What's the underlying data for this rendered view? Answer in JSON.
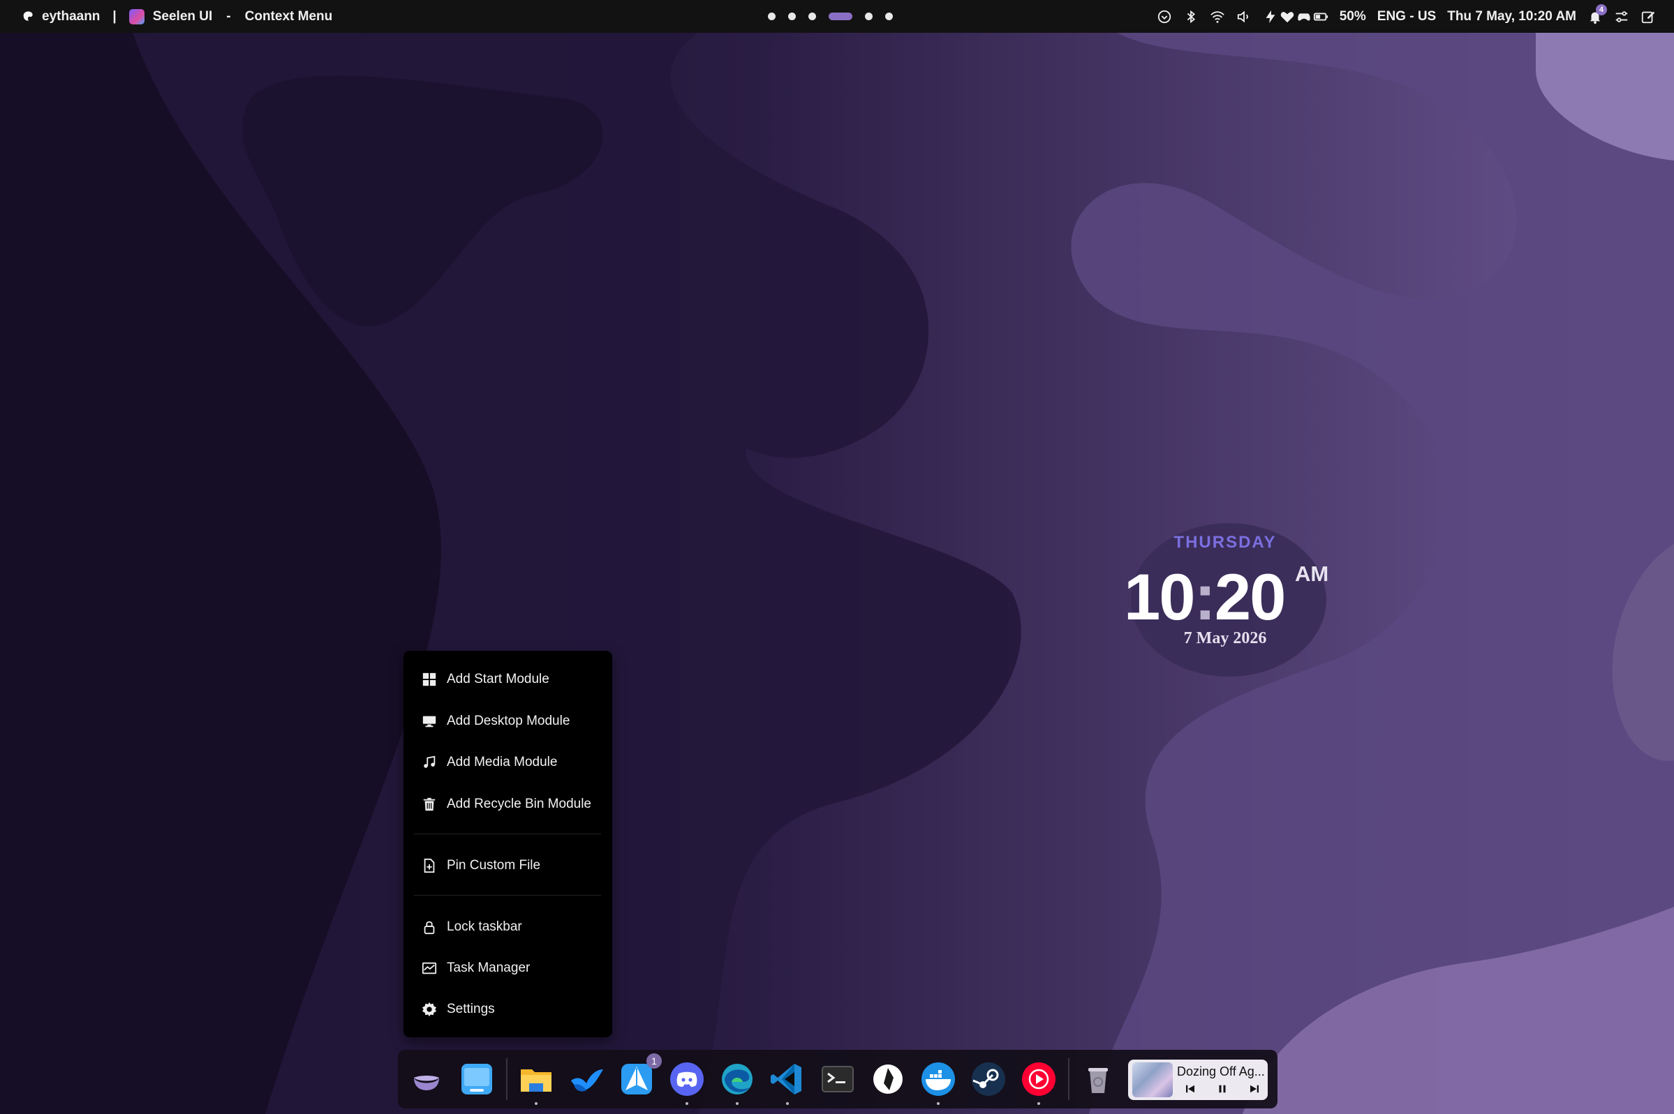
{
  "topbar": {
    "user": "eythaann",
    "separator": "|",
    "app_name": "Seelen UI",
    "dash": "-",
    "window_title": "Context Menu",
    "battery": "50%",
    "language": "ENG - US",
    "datetime": "Thu 7 May, 10:20 AM",
    "notification_count": "4",
    "workspaces": 6,
    "active_workspace": 4
  },
  "clock_widget": {
    "day": "THURSDAY",
    "hours": "10",
    "colon": ":",
    "minutes": "20",
    "ampm": "AM",
    "date": "7 May 2026"
  },
  "context_menu": {
    "items": [
      {
        "label": "Add Start Module",
        "icon": "windows-icon"
      },
      {
        "label": "Add Desktop Module",
        "icon": "monitor-icon"
      },
      {
        "label": "Add Media Module",
        "icon": "music-note-icon"
      },
      {
        "label": "Add Recycle Bin Module",
        "icon": "trash-icon"
      },
      {
        "label": "Pin Custom File",
        "icon": "file-plus-icon"
      },
      {
        "label": "Lock taskbar",
        "icon": "lock-icon"
      },
      {
        "label": "Task Manager",
        "icon": "task-manager-icon"
      },
      {
        "label": "Settings",
        "icon": "gear-icon"
      }
    ]
  },
  "dock": {
    "apps": [
      {
        "name": "seelen-start",
        "icon": "seelen-logo-icon"
      },
      {
        "name": "desktop",
        "icon": "desktop-icon"
      },
      {
        "name": "file-explorer",
        "icon": "folder-icon"
      },
      {
        "name": "bluesky",
        "icon": "bluesky-icon"
      },
      {
        "name": "spark-mail",
        "icon": "paper-plane-icon",
        "badge": "1"
      },
      {
        "name": "discord",
        "icon": "discord-icon"
      },
      {
        "name": "edge",
        "icon": "edge-icon"
      },
      {
        "name": "vscode",
        "icon": "vscode-icon"
      },
      {
        "name": "terminal",
        "icon": "terminal-icon"
      },
      {
        "name": "obsidian",
        "icon": "obsidian-icon"
      },
      {
        "name": "docker",
        "icon": "docker-icon"
      },
      {
        "name": "steam",
        "icon": "steam-icon"
      },
      {
        "name": "youtube-music",
        "icon": "youtube-music-icon"
      },
      {
        "name": "recycle-bin",
        "icon": "recycle-bin-icon"
      }
    ],
    "media": {
      "title": "Dozing Off Ag..."
    }
  },
  "colors": {
    "accent": "#8b6fc4",
    "clock_day": "#7b6fe0",
    "menu_bg": "#000000",
    "topbar_bg": "#121212"
  }
}
